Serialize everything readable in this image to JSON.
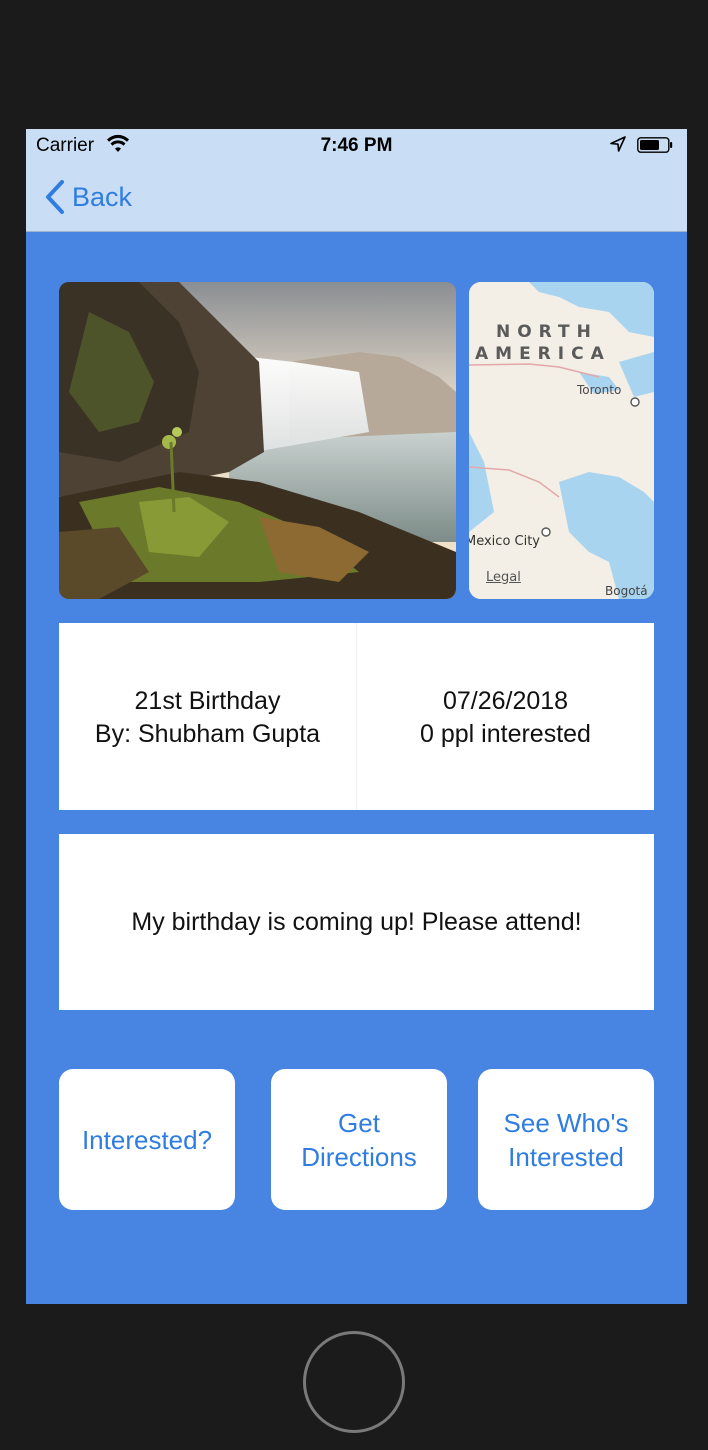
{
  "status_bar": {
    "carrier": "Carrier",
    "time": "7:46 PM",
    "wifi_icon": "wifi-icon",
    "location_icon": "location-arrow-icon",
    "battery_icon": "battery-icon"
  },
  "nav": {
    "back_label": "Back",
    "back_icon": "chevron-left-icon"
  },
  "media": {
    "photo": "waterfall-photo",
    "map": {
      "labels": {
        "north": "NORTH",
        "america": "AMERICA",
        "toronto": "Toronto",
        "mexico_city": "Mexico City",
        "legal": "Legal",
        "bogota": "Bogotá"
      }
    }
  },
  "event": {
    "title": "21st Birthday",
    "host": "By: Shubham Gupta",
    "date": "07/26/2018",
    "interest": "0 ppl interested",
    "description": "My birthday is coming up! Please attend!"
  },
  "actions": {
    "interested": "Interested?",
    "directions": "Get Directions",
    "see_who": "See Who's Interested"
  },
  "colors": {
    "screen_bg": "#4884e2",
    "nav_bg": "#c9def5",
    "accent": "#2f7de1"
  }
}
